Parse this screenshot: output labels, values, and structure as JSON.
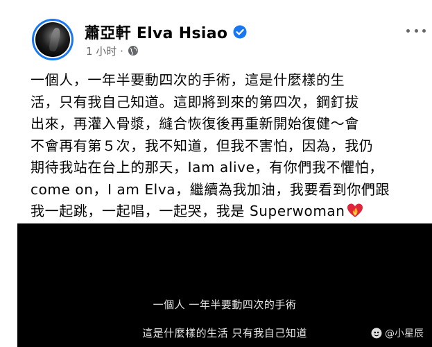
{
  "author": {
    "name": "蕭亞軒 Elva Hsiao",
    "verified_icon": "verified-badge-icon",
    "timestamp": "1 小时 ·",
    "privacy_icon": "globe-icon"
  },
  "post": {
    "lines": [
      "一個人，一年半要動四次的手術，這是什麼樣的生",
      "活，只有我自己知道。這即將到來的第四次，鋼釘拔",
      "出來，再灌入骨漿，縫合恢復後再重新開始復健～會",
      "不會再有第５次，我不知道，但我不害怕，因為，我仍",
      "期待我站在台上的那天，Iam alive，有你們我不懼怕，",
      "come on，I am Elva，繼續為我加油，我要看到你們跟",
      "我一起跳，一起唱，一起哭，我是 Superwoman"
    ],
    "trailing_emoji": "heart-on-fire-emoji"
  },
  "video": {
    "subtitle_1": "一個人 一年半要動四次的手術",
    "subtitle_2": "這是什麼樣的生活 只有我自己知道",
    "watermark": "@小星辰"
  },
  "colors": {
    "accent": "#1877f2",
    "text": "#050505",
    "secondary_text": "#65676b",
    "video_bg": "#000000"
  }
}
